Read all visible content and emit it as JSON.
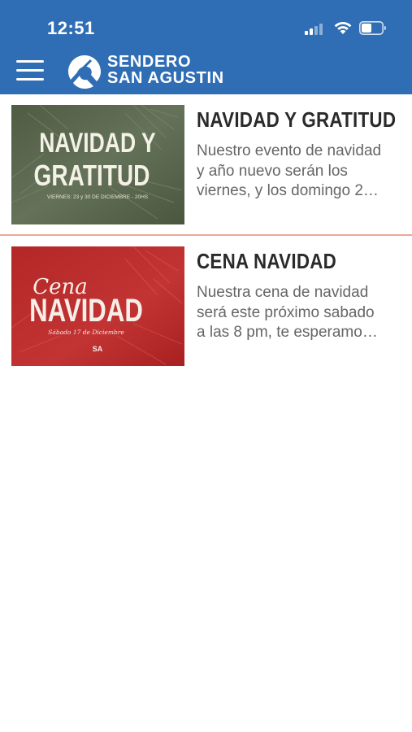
{
  "status_bar": {
    "time": "12:51"
  },
  "header": {
    "logo_line1": "SENDERO",
    "logo_line2": "SAN AGUSTIN"
  },
  "colors": {
    "header_blue": "#2f6db5",
    "divider": "#eaa996",
    "thumb1_bg": "#5e6b4f",
    "thumb2_bg": "#b62a2a"
  },
  "events": [
    {
      "title": "NAVIDAD Y GRATITUD",
      "description_lines": [
        "Nuestro evento de navidad",
        "y año nuevo serán los",
        "viernes, y los domingo 2…"
      ],
      "image": {
        "line1": "NAVIDAD Y",
        "line2": "GRATITUD",
        "caption": "VIERNES: 23 y 30 DE DICIEMBRE - 20HS"
      }
    },
    {
      "title": "CENA NAVIDAD",
      "description_lines": [
        "Nuestra cena de navidad",
        "será este próximo sabado",
        "a las 8 pm, te esperamo…"
      ],
      "image": {
        "script": "Cena",
        "line1": "NAVIDAD",
        "caption": "Sábado 17 de Diciembre",
        "badge": "SA"
      }
    }
  ]
}
